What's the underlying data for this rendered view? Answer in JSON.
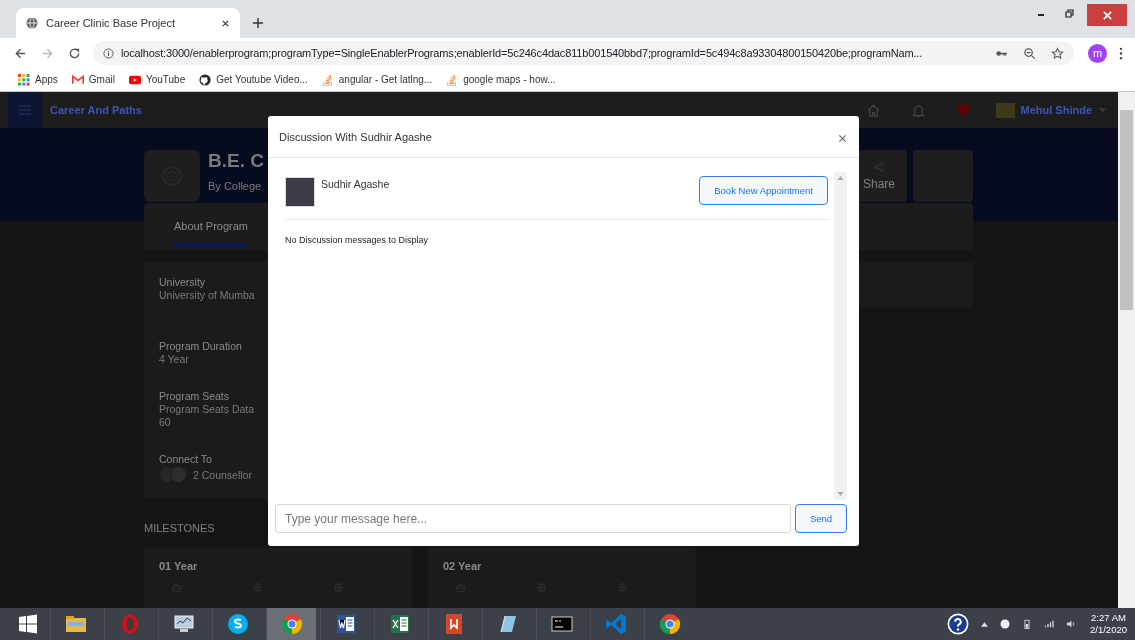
{
  "browser": {
    "tab_title": "Career Clinic Base Project",
    "url": "localhost:3000/enablerprogram;programType=SingleEnablerPrograms;enablerId=5c246c4dac811b001540bbd7;programId=5c494c8a93304800150420be;programNam...",
    "profile_initial": "m",
    "bookmarks": [
      {
        "label": "Apps",
        "kind": "apps"
      },
      {
        "label": "Gmail",
        "kind": "gmail"
      },
      {
        "label": "YouTube",
        "kind": "youtube"
      },
      {
        "label": "Get Youtube Video...",
        "kind": "github"
      },
      {
        "label": "angular - Get latlng...",
        "kind": "stack"
      },
      {
        "label": "google maps - how...",
        "kind": "stack"
      }
    ]
  },
  "app": {
    "brand": "Career And Paths",
    "user_name": "Mehul Shinde"
  },
  "program": {
    "title": "B.E. C",
    "by": "By College",
    "share": "Share",
    "tabs": [
      {
        "label": "About Program",
        "selected": true
      }
    ],
    "details": [
      {
        "label": "University",
        "values": [
          "University of Mumba"
        ]
      },
      {
        "label": "Program Duration",
        "values": [
          "4 Year"
        ]
      },
      {
        "label": "Program Seats",
        "values": [
          "Program Seats Data",
          "60"
        ]
      }
    ],
    "connect": {
      "label": "Connect To",
      "counsellors": "2 Counsellor"
    },
    "milestones": {
      "heading": "MILESTONES",
      "years": [
        "01 Year",
        "02 Year"
      ]
    }
  },
  "dialog": {
    "title": "Discussion With Sudhir Agashe",
    "counsellor_name": "Sudhir Agashe",
    "book_button": "Book New Appointment",
    "empty_message": "No Discussion messages to Display",
    "composer": {
      "placeholder": "Type your message here..."
    },
    "send_button": "Send"
  },
  "taskbar": {
    "apps": [
      {
        "kind": "explorer",
        "selected": false
      },
      {
        "kind": "opera",
        "selected": false
      },
      {
        "kind": "monitor",
        "selected": false
      },
      {
        "kind": "skype",
        "selected": false
      },
      {
        "kind": "chrome",
        "selected": true
      },
      {
        "kind": "word",
        "selected": false
      },
      {
        "kind": "excel",
        "selected": false
      },
      {
        "kind": "acrobat",
        "selected": false
      },
      {
        "kind": "notepad",
        "selected": false
      },
      {
        "kind": "terminal",
        "selected": false
      },
      {
        "kind": "vscode",
        "selected": false
      },
      {
        "kind": "chrome",
        "selected": false
      }
    ],
    "time": "2:27 AM",
    "date": "2/1/2020"
  }
}
